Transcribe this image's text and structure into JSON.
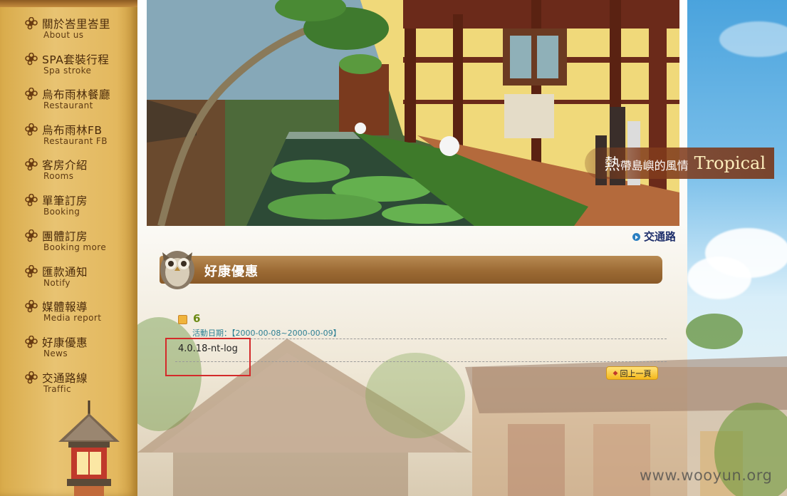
{
  "sidebar": {
    "items": [
      {
        "title": "關於峇里峇里",
        "subtitle": "About us"
      },
      {
        "title": "SPA套裝行程",
        "subtitle": "Spa stroke"
      },
      {
        "title": "烏布雨林餐廳",
        "subtitle": "Restaurant"
      },
      {
        "title": "烏布雨林FB",
        "subtitle": "Restaurant FB"
      },
      {
        "title": "客房介紹",
        "subtitle": "Rooms"
      },
      {
        "title": "單筆訂房",
        "subtitle": "Booking"
      },
      {
        "title": "團體訂房",
        "subtitle": "Booking more"
      },
      {
        "title": "匯款通知",
        "subtitle": "Notify"
      },
      {
        "title": "媒體報導",
        "subtitle": "Media report"
      },
      {
        "title": "好康優惠",
        "subtitle": "News"
      },
      {
        "title": "交通路線",
        "subtitle": "Traffic"
      }
    ]
  },
  "banner": {
    "caption_big": "熱",
    "caption_zh": "帶島嶼的風情",
    "caption_en": "Tropical"
  },
  "top_link": {
    "label": "交通路線"
  },
  "section": {
    "title": "好康優惠"
  },
  "news_item": {
    "title": "6",
    "date": "活動日期：【2000-00-08~2000-00-09】",
    "content": "4.0.18-nt-log"
  },
  "back_button": {
    "label": "回上一頁"
  },
  "watermark": "www.wooyun.org",
  "colors": {
    "sidebar": "#e3b85e",
    "section_bar": "#9b6a34",
    "highlight": "#d42a2a",
    "date_text": "#2c7f93",
    "title_text": "#6c8a14"
  }
}
